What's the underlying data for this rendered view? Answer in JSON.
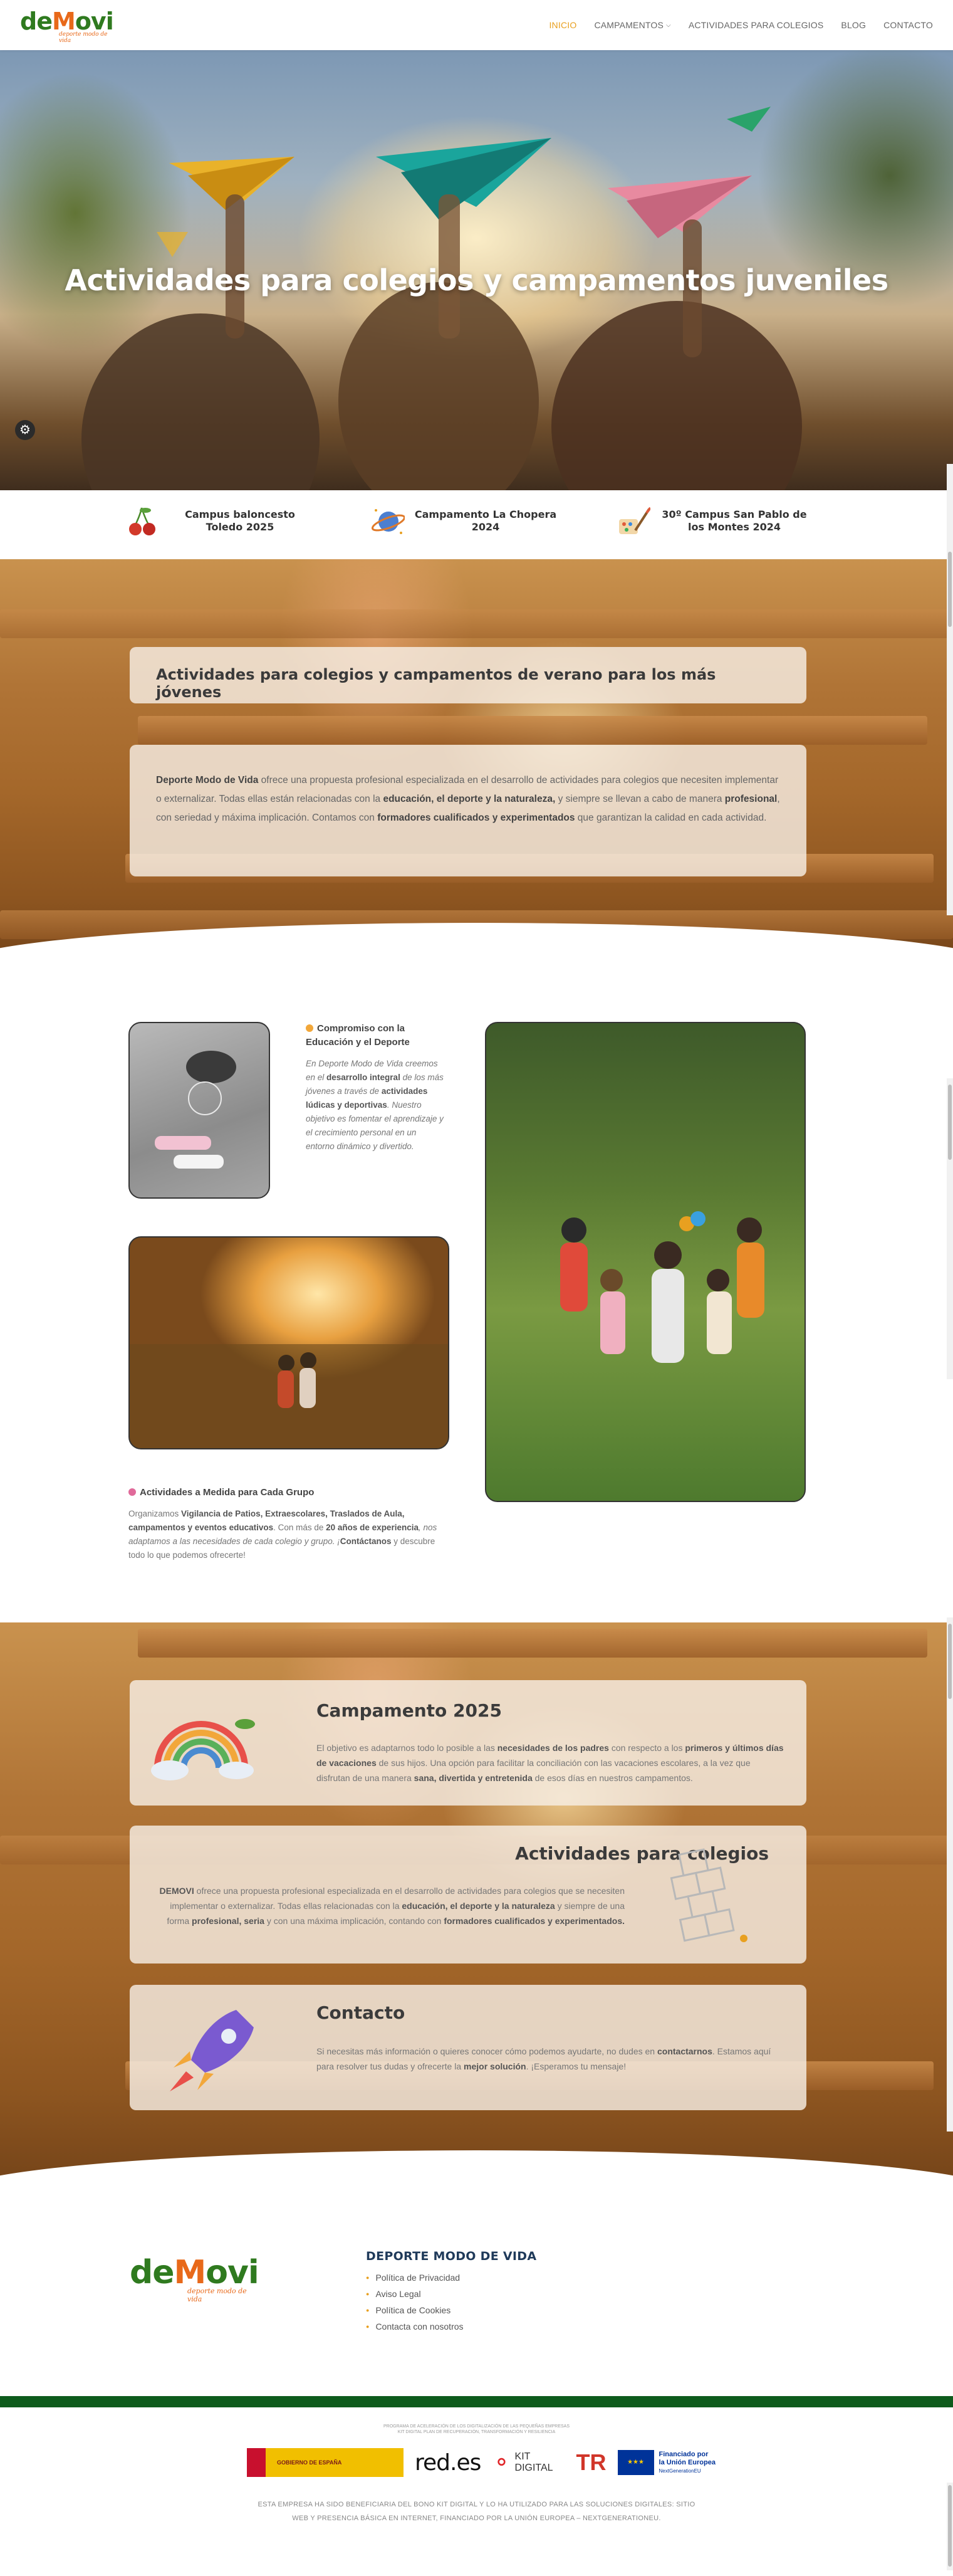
{
  "header": {
    "logo_text_left": "de",
    "logo_text_mid": "M",
    "logo_text_right": "ovi",
    "logo_tagline": "deporte modo de vida",
    "nav": [
      {
        "label": "INICIO",
        "active": true
      },
      {
        "label": "CAMPAMENTOS",
        "has_dropdown": true
      },
      {
        "label": "ACTIVIDADES PARA COLEGIOS"
      },
      {
        "label": "BLOG"
      },
      {
        "label": "CONTACTO"
      }
    ]
  },
  "hero": {
    "title": "Actividades para colegios y campamentos juveniles"
  },
  "campus": [
    {
      "name": "Campus baloncesto Toledo 2025",
      "icon": "cherries-icon"
    },
    {
      "name": "Campamento La Chopera 2024",
      "icon": "planet-icon"
    },
    {
      "name": "30º Campus San Pablo de los Montes 2024",
      "icon": "paint-icon"
    }
  ],
  "intro": {
    "title": "Actividades para colegios y campamentos de verano para los más jóvenes",
    "p1_b1": "Deporte Modo de Vida",
    "p1_t1": " ofrece una propuesta profesional especializada en el desarrollo de actividades para colegios que necesiten implementar o externalizar. Todas ellas están relacionadas con la ",
    "p1_b2": "educación, el deporte y la naturaleza,",
    "p1_t2": " y siempre se llevan a cabo de manera ",
    "p1_b3": "profesional",
    "p1_t3": ", con seriedad y máxima implicación. Contamos con ",
    "p1_b4": "formadores cualificados y experimentados",
    "p1_t4": " que garantizan la calidad en cada actividad."
  },
  "features": {
    "commitment_title": "Compromiso con la Educación y el Deporte",
    "commitment_t1": "En Deporte Modo de Vida creemos en el ",
    "commitment_b1": "desarrollo integral",
    "commitment_t2": " de los más jóvenes a través de ",
    "commitment_b2": "actividades lúdicas y deportivas",
    "commitment_t3": ". Nuestro objetivo es fomentar el aprendizaje y el crecimiento personal en un entorno dinámico y divertido.",
    "custom_title": "Actividades a Medida para Cada Grupo",
    "custom_t1": "Organizamos ",
    "custom_b1": "Vigilancia de Patios, Extraescolares, Traslados de Aula, campamentos y eventos educativos",
    "custom_t2": ". Con más de ",
    "custom_b2": "20 años de experiencia",
    "custom_t3": ", nos adaptamos a las necesidades de cada colegio y grupo. ¡",
    "custom_b3": "Contáctanos",
    "custom_t4": " y descubre todo lo que podemos ofrecerte!"
  },
  "cards": {
    "camp_title": "Campamento 2025",
    "camp_t1": "El objetivo es adaptarnos todo lo posible a las ",
    "camp_b1": "necesidades de los padres",
    "camp_t2": " con respecto a los ",
    "camp_b2": "primeros y últimos días de vacaciones",
    "camp_t3": " de sus hijos. Una opción para facilitar la conciliación con las vacaciones escolares, a la vez que disfrutan de una manera ",
    "camp_b3": "sana, divertida y entretenida",
    "camp_t4": " de esos días en nuestros campamentos.",
    "school_title": "Actividades para colegios",
    "school_b0": "DEMOVI",
    "school_t1": " ofrece una propuesta profesional especializada en el desarrollo de actividades para colegios que se necesiten implementar o externalizar. Todas ellas relacionadas con la ",
    "school_b1": "educación, el deporte y la naturaleza",
    "school_t2": " y siempre de una forma ",
    "school_b2": "profesional, seria",
    "school_t3": " y con una máxima implicación, contando con ",
    "school_b3": "formadores cualificados y experimentados.",
    "contact_title": "Contacto",
    "contact_t1": "Si necesitas más información o quieres conocer cómo podemos ayudarte, no dudes en ",
    "contact_b1": "contactarnos",
    "contact_t2": ". Estamos aquí para resolver tus dudas y ofrecerte la ",
    "contact_b2": "mejor solución",
    "contact_t3": ". ¡Esperamos tu mensaje!"
  },
  "footer": {
    "heading": "DEPORTE MODO DE VIDA",
    "links": [
      "Política de Privacidad",
      "Aviso Legal",
      "Política de Cookies",
      "Contacta con nosotros"
    ],
    "kit_small_1": "PROGRAMA DE ACELERACIÓN DE LOS DIGITALIZACIÓN DE LAS PEQUEÑAS EMPRESAS",
    "kit_small_2": "KIT DIGITAL PLAN DE RECUPERACIÓN, TRANSFORMACIÓN Y RESILIENCIA",
    "logo_gov": "GOBIERNO DE ESPAÑA",
    "logo_redes": "red.es",
    "logo_kit": "KIT DIGITAL",
    "logo_eu_line1": "Financiado por",
    "logo_eu_line2": "la Unión Europea",
    "logo_eu_line3": "NextGenerationEU",
    "caption_line1": "ESTA EMPRESA HA SIDO BENEFICIARIA DEL BONO KIT DIGITAL Y LO HA UTILIZADO PARA LAS SOLUCIONES DIGITALES: SITIO",
    "caption_line2": "WEB Y PRESENCIA BÁSICA EN INTERNET, FINANCIADO POR LA UNIÓN EUROPEA – NEXTGENERATIONEU."
  },
  "colors": {
    "accent": "#e8a020",
    "brand_green": "#2f7a1f",
    "brand_orange": "#e8691a",
    "footer_green": "#0e5b1c",
    "footer_heading": "#1f3a5a"
  }
}
